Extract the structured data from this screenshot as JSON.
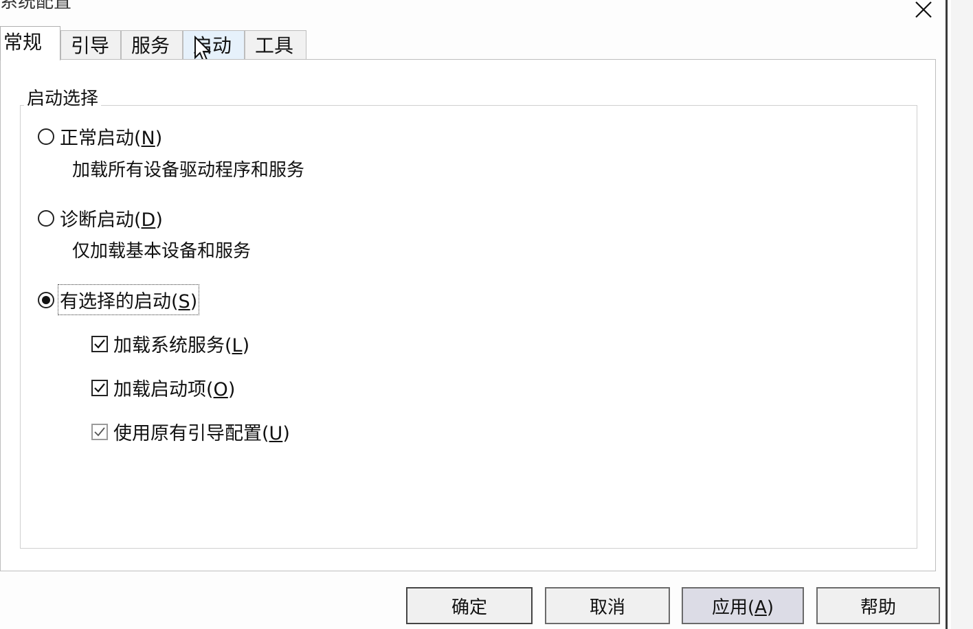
{
  "window": {
    "title_partial": "系统配置"
  },
  "tabs": [
    {
      "label": "常规",
      "active": true
    },
    {
      "label": "引导",
      "active": false
    },
    {
      "label": "服务",
      "active": false
    },
    {
      "label": "启动",
      "active": false
    },
    {
      "label": "工具",
      "active": false
    }
  ],
  "group": {
    "title": "启动选择",
    "normal": {
      "label": "正常启动(N)",
      "label_main": "正常启动(",
      "label_key": "N",
      "label_end": ")",
      "description": "加载所有设备驱动程序和服务",
      "selected": false
    },
    "diagnostic": {
      "label": "诊断启动(D)",
      "label_main": "诊断启动(",
      "label_key": "D",
      "label_end": ")",
      "description": "仅加载基本设备和服务",
      "selected": false
    },
    "selective": {
      "label": "有选择的启动(S)",
      "label_main": "有选择的启动(",
      "label_key": "S",
      "label_end": ")",
      "selected": true,
      "options": [
        {
          "label_main": "加载系统服务(",
          "label_key": "L",
          "label_end": ")",
          "checked": true,
          "enabled": true
        },
        {
          "label_main": "加载启动项(",
          "label_key": "O",
          "label_end": ")",
          "checked": true,
          "enabled": true
        },
        {
          "label_main": "使用原有引导配置(",
          "label_key": "U",
          "label_end": ")",
          "checked": true,
          "enabled": false
        }
      ]
    }
  },
  "buttons": {
    "ok": "确定",
    "cancel": "取消",
    "apply_main": "应用(",
    "apply_key": "A",
    "apply_end": ")",
    "help": "帮助"
  }
}
